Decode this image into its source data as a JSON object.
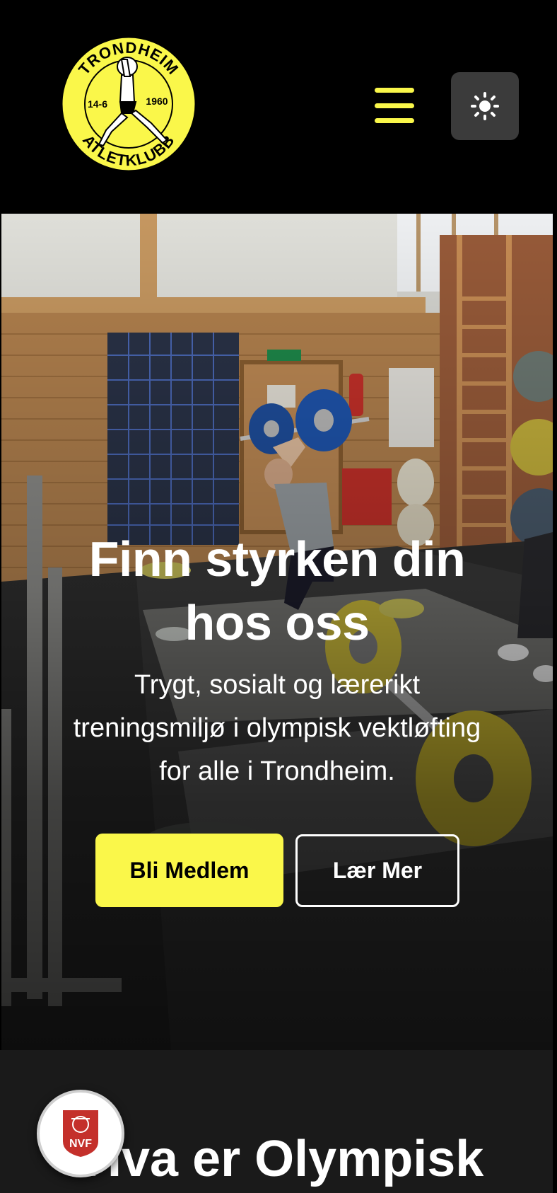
{
  "header": {
    "logo": {
      "top_text": "TRONDHEIM",
      "bottom_text": "ATLETKLUBB",
      "date_left": "14-6",
      "date_right": "1960"
    },
    "menu_icon": "hamburger-icon",
    "theme_icon": "sun-icon"
  },
  "hero": {
    "title": "Finn styrken din hos oss",
    "subtitle": "Trygt, sosialt og lærerikt treningsmiljø i olympisk vektløfting for alle i Trondheim.",
    "primary_button": "Bli Medlem",
    "secondary_button": "Lær Mer"
  },
  "section": {
    "title": "Hva er Olympisk"
  },
  "badge": {
    "text": "NVF"
  },
  "colors": {
    "accent": "#faf74a",
    "background": "#000000",
    "section_bg": "#1a1a1a",
    "badge_red": "#c4302b"
  }
}
